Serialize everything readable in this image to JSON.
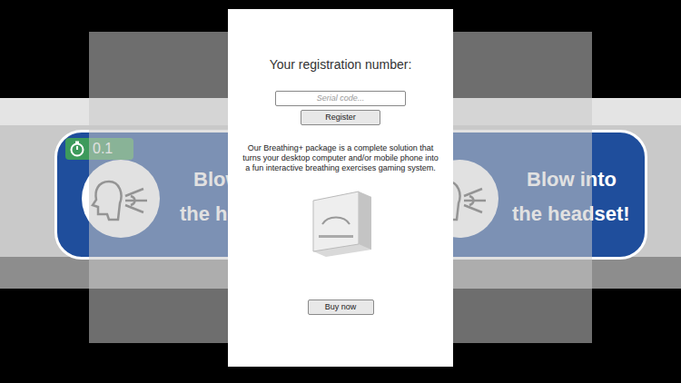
{
  "scene": {
    "timer": "0.1",
    "banners": [
      {
        "lines": [
          "Blow",
          "the he"
        ]
      },
      {
        "lines": [
          "Blow into",
          "the headset!"
        ]
      }
    ]
  },
  "dialog": {
    "title": "Your registration number:",
    "serial": {
      "placeholder": "Serial code..."
    },
    "register_button": "Register",
    "description": "Our Breathing+ package is a complete solution that turns your desktop computer and/or mobile phone into a fun interactive breathing exercises gaming system.",
    "buy_button": "Buy now"
  }
}
